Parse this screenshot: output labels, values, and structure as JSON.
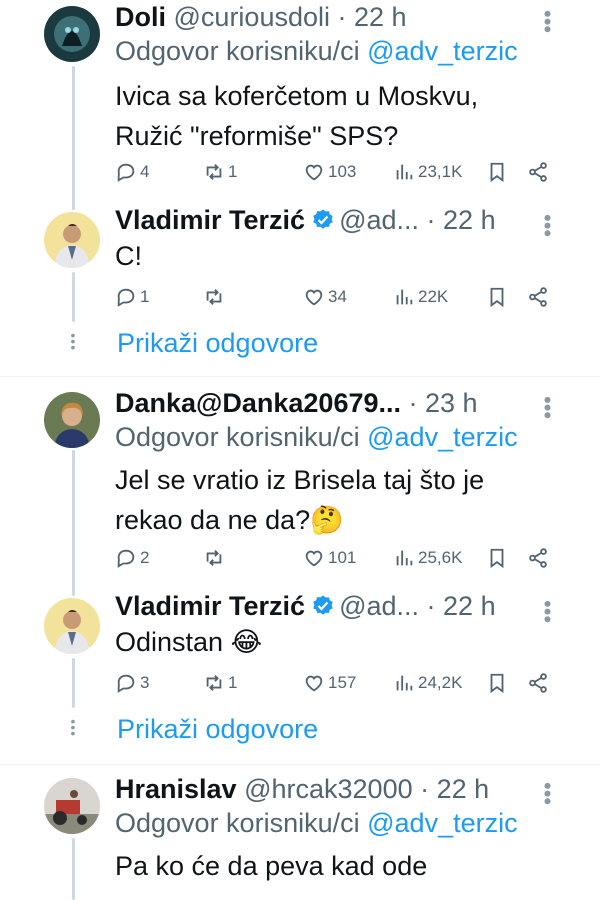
{
  "colors": {
    "accent": "#1d9bf0",
    "muted": "#536471",
    "text": "#0f1419",
    "line": "#cfd9de"
  },
  "tweets": [
    {
      "name": "Doli",
      "handle": "@curiousdoli",
      "time": "· 22 h",
      "replying_prefix": "Odgovor korisniku/ci",
      "replying_to": "@adv_terzic",
      "text_lines": [
        "Ivica sa koferčetom u Moskvu,",
        "Ružić \"reformiše\" SPS?"
      ],
      "replies": "4",
      "reposts": "1",
      "likes": "103",
      "views": "23,1K"
    },
    {
      "name": "Vladimir Terzić",
      "handle": "@ad...",
      "time": "· 22 h",
      "verified": true,
      "text_lines": [
        "C!"
      ],
      "replies": "1",
      "reposts": "",
      "likes": "34",
      "views": "22K"
    },
    {
      "name": "Danka@Danka20679...",
      "handle": "",
      "time": "· 23 h",
      "replying_prefix": "Odgovor korisniku/ci",
      "replying_to": "@adv_terzic",
      "text_lines": [
        "Jel se vratio iz Brisela taj što je",
        "rekao da ne da?🤔"
      ],
      "replies": "2",
      "reposts": "",
      "likes": "101",
      "views": "25,6K"
    },
    {
      "name": "Vladimir Terzić",
      "handle": "@ad...",
      "time": "· 22 h",
      "verified": true,
      "text_lines": [
        "Odinstan 😂"
      ],
      "replies": "3",
      "reposts": "1",
      "likes": "157",
      "views": "24,2K"
    },
    {
      "name": "Hranislav",
      "handle": "@hrcak32000",
      "time": "· 22 h",
      "replying_prefix": "Odgovor korisniku/ci",
      "replying_to": "@adv_terzic",
      "text_lines": [
        "Pa ko će da peva kad ode"
      ]
    }
  ],
  "show_replies_label": "Prikaži odgovore",
  "icons": [
    "reply-icon",
    "repost-icon",
    "like-icon",
    "views-icon",
    "bookmark-icon",
    "share-icon",
    "verified-icon",
    "more-icon"
  ]
}
